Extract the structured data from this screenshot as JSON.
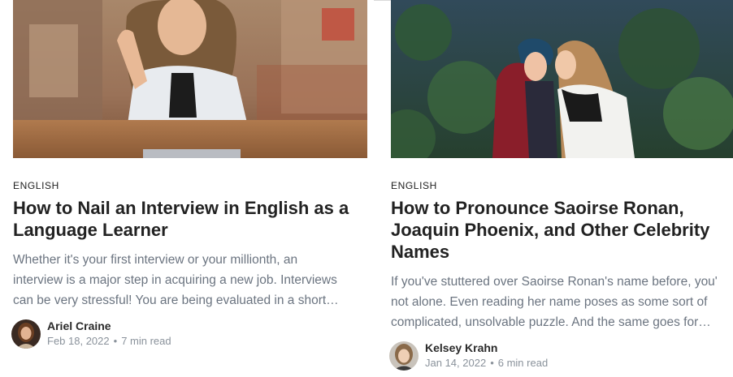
{
  "articles": [
    {
      "category": "ENGLISH",
      "title": "How to Nail an Interview in English as a Language Learner",
      "excerpt_lines": [
        "Whether it's your first interview or your millionth, an",
        "interview is a major step in acquiring a new job. Interviews",
        "can be very stressful! You are being evaluated in a short…"
      ],
      "author": "Ariel Craine",
      "date": "Feb 18, 2022",
      "separator": "•",
      "read_time": "7 min read"
    },
    {
      "category": "ENGLISH",
      "title": "How to Pronounce Saoirse Ronan, Joaquin Phoenix, and Other Celebrity Names",
      "excerpt_lines": [
        "If you've stuttered over Saoirse Ronan's name before, you'",
        "not alone. Even reading her name poses as some sort of",
        "complicated, unsolvable puzzle. And the same goes for…"
      ],
      "author": "Kelsey Krahn",
      "date": "Jan 14, 2022",
      "separator": "•",
      "read_time": "6 min read"
    }
  ]
}
